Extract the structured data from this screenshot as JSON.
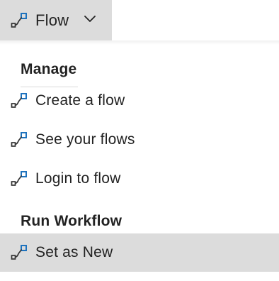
{
  "toolbar": {
    "title": "Flow",
    "icon": "flow-icon",
    "dropdown_icon": "chevron-down-icon"
  },
  "menu": {
    "sections": [
      {
        "title": "Manage",
        "items": [
          {
            "label": "Create a flow",
            "icon": "flow-icon"
          },
          {
            "label": "See your flows",
            "icon": "flow-icon"
          },
          {
            "label": "Login to flow",
            "icon": "flow-icon"
          }
        ]
      },
      {
        "title": "Run Workflow",
        "items": [
          {
            "label": "Set as New",
            "icon": "flow-icon",
            "selected": true
          }
        ]
      }
    ]
  },
  "colors": {
    "toolbar_background": "#dcdcdc",
    "selected_background": "#dcdcdc",
    "text": "#222222",
    "icon_accent": "#1e73be"
  }
}
